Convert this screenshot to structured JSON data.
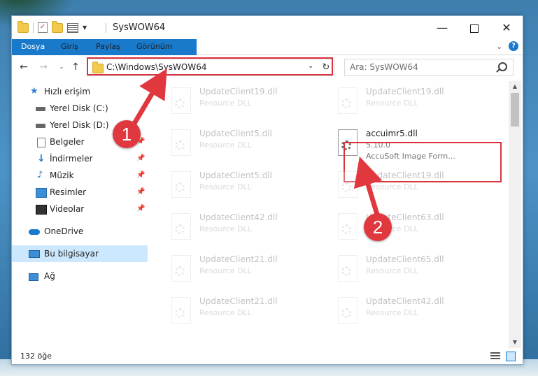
{
  "window": {
    "title": "SysWOW64",
    "controls": {
      "minimize": "—",
      "maximize": "",
      "close": "✕"
    }
  },
  "ribbon": {
    "tabs": [
      "Dosya",
      "Giriş",
      "Paylaş",
      "Görünüm"
    ],
    "help": "?"
  },
  "navigation": {
    "address": "C:\\Windows\\SysWOW64",
    "search_placeholder": "Ara: SysWOW64",
    "refresh_glyph": "↻"
  },
  "sidebar": {
    "items": [
      {
        "label": "Hızlı erişim",
        "icon": "star-icon",
        "pinned": false,
        "selected": false
      },
      {
        "label": "Yerel Disk (C:)",
        "icon": "disk-icon",
        "pinned": false,
        "selected": false
      },
      {
        "label": "Yerel Disk (D:)",
        "icon": "disk-icon",
        "pinned": false,
        "selected": false
      },
      {
        "label": "Belgeler",
        "icon": "document-icon",
        "pinned": true,
        "selected": false
      },
      {
        "label": "İndirmeler",
        "icon": "download-icon",
        "pinned": true,
        "selected": false
      },
      {
        "label": "Müzik",
        "icon": "music-icon",
        "pinned": true,
        "selected": false
      },
      {
        "label": "Resimler",
        "icon": "picture-icon",
        "pinned": true,
        "selected": false
      },
      {
        "label": "Videolar",
        "icon": "video-icon",
        "pinned": true,
        "selected": false
      },
      {
        "label": "OneDrive",
        "icon": "cloud-icon",
        "pinned": false,
        "selected": false
      },
      {
        "label": "Bu bilgisayar",
        "icon": "computer-icon",
        "pinned": false,
        "selected": true
      },
      {
        "label": "Ağ",
        "icon": "network-icon",
        "pinned": false,
        "selected": false
      }
    ]
  },
  "files": {
    "items": [
      {
        "name": "UpdateClient19.dll",
        "desc": "Resource DLL"
      },
      {
        "name": "UpdateClient19.dll",
        "desc": "Resource DLL"
      },
      {
        "name": "UpdateClient5.dll",
        "desc": "Resource DLL"
      },
      {
        "name": "accuimr5.dll",
        "desc": "5.10.0",
        "desc2": "AccuSoft Image Form...",
        "highlighted": true
      },
      {
        "name": "UpdateClient5.dll",
        "desc": "Resource DLL"
      },
      {
        "name": "UpdateClient19.dll",
        "desc": "Resource DLL"
      },
      {
        "name": "UpdateClient42.dll",
        "desc": "Resource DLL"
      },
      {
        "name": "UpdateClient63.dll",
        "desc": "Resource DLL"
      },
      {
        "name": "UpdateClient21.dll",
        "desc": "Resource DLL"
      },
      {
        "name": "UpdateClient65.dll",
        "desc": "Resource DLL"
      },
      {
        "name": "UpdateClient21.dll",
        "desc": "Resource DLL"
      },
      {
        "name": "UpdateClient42.dll",
        "desc": "Resource DLL"
      }
    ]
  },
  "status": {
    "count": "132 öğe"
  },
  "annotations": {
    "step1": "1",
    "step2": "2",
    "color": "#e0383e"
  },
  "colors": {
    "accent": "#1979ca",
    "highlight_box": "#d9333c",
    "selected_bg": "#cce8ff"
  }
}
